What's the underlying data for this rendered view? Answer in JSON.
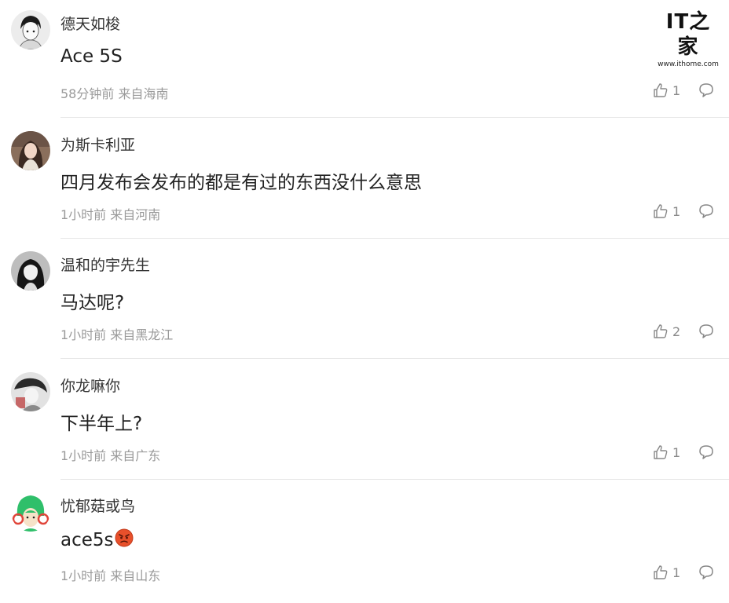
{
  "watermark": {
    "logo": "IT之家",
    "url": "www.ithome.com"
  },
  "comments": [
    {
      "username": "德天如梭",
      "content": "Ace 5S",
      "meta": "58分钟前 来自海南",
      "likes": "1"
    },
    {
      "username": "为斯卡利亚",
      "content": "四月发布会发布的都是有过的东西没什么意思",
      "meta": "1小时前 来自河南",
      "likes": "1"
    },
    {
      "username": "温和的宇先生",
      "content": "马达呢?",
      "meta": "1小时前 来自黑龙江",
      "likes": "2"
    },
    {
      "username": "你龙嘛你",
      "content": "下半年上?",
      "meta": "1小时前 来自广东",
      "likes": "1"
    },
    {
      "username": "忧郁菇或鸟",
      "content": "ace5s",
      "meta": "1小时前 来自山东",
      "likes": "1",
      "emoji": "angry-face-emoji"
    }
  ],
  "icons": {
    "like": "thumbs-up-icon",
    "reply": "comment-bubble-icon"
  }
}
